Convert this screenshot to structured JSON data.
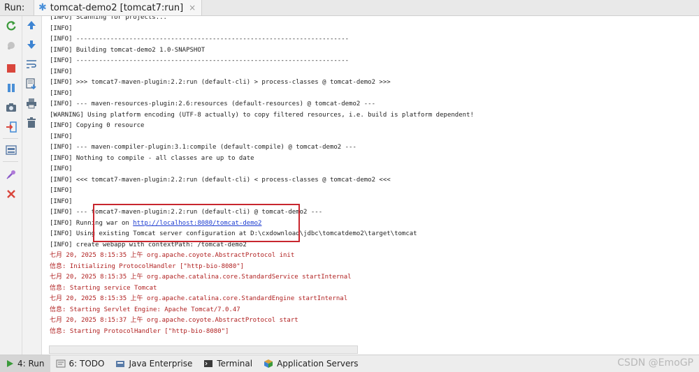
{
  "header": {
    "run_label": "Run:",
    "tab_title": "tomcat-demo2 [tomcat7:run]",
    "tab_close": "×"
  },
  "console": {
    "lines": [
      {
        "text": "[INFO] Scanning for projects...",
        "kind": "info"
      },
      {
        "text": "[INFO]",
        "kind": "info"
      },
      {
        "text": "[INFO] ------------------------------------------------------------------------",
        "kind": "info"
      },
      {
        "text": "[INFO] Building tomcat-demo2 1.0-SNAPSHOT",
        "kind": "info"
      },
      {
        "text": "[INFO] ------------------------------------------------------------------------",
        "kind": "info"
      },
      {
        "text": "[INFO]",
        "kind": "info"
      },
      {
        "text": "[INFO] >>> tomcat7-maven-plugin:2.2:run (default-cli) > process-classes @ tomcat-demo2 >>>",
        "kind": "info"
      },
      {
        "text": "[INFO]",
        "kind": "info"
      },
      {
        "text": "[INFO] --- maven-resources-plugin:2.6:resources (default-resources) @ tomcat-demo2 ---",
        "kind": "info"
      },
      {
        "text": "[WARNING] Using platform encoding (UTF-8 actually) to copy filtered resources, i.e. build is platform dependent!",
        "kind": "info"
      },
      {
        "text": "[INFO] Copying 0 resource",
        "kind": "info"
      },
      {
        "text": "[INFO]",
        "kind": "info"
      },
      {
        "text": "[INFO] --- maven-compiler-plugin:3.1:compile (default-compile) @ tomcat-demo2 ---",
        "kind": "info"
      },
      {
        "text": "[INFO] Nothing to compile - all classes are up to date",
        "kind": "info"
      },
      {
        "text": "[INFO]",
        "kind": "info"
      },
      {
        "text": "[INFO] <<< tomcat7-maven-plugin:2.2:run (default-cli) < process-classes @ tomcat-demo2 <<<",
        "kind": "info"
      },
      {
        "text": "[INFO]",
        "kind": "info"
      },
      {
        "text": "[INFO]",
        "kind": "info"
      },
      {
        "text": "[INFO] --- tomcat7-maven-plugin:2.2:run (default-cli) @ tomcat-demo2 ---",
        "kind": "info"
      },
      {
        "text": "[INFO] Running war on ",
        "kind": "info",
        "link": "http://localhost:8080/tomcat-demo2"
      },
      {
        "text": "[INFO] Using existing Tomcat server configuration at D:\\cxdownload\\jdbc\\tomcatdemo2\\target\\tomcat",
        "kind": "info"
      },
      {
        "text": "[INFO] create webapp with contextPath: /tomcat-demo2",
        "kind": "info"
      },
      {
        "text": "七月 20, 2025 8:15:35 上午 org.apache.coyote.AbstractProtocol init",
        "kind": "err"
      },
      {
        "text": "信息: Initializing ProtocolHandler [\"http-bio-8080\"]",
        "kind": "err"
      },
      {
        "text": "七月 20, 2025 8:15:35 上午 org.apache.catalina.core.StandardService startInternal",
        "kind": "err"
      },
      {
        "text": "信息: Starting service Tomcat",
        "kind": "err"
      },
      {
        "text": "七月 20, 2025 8:15:35 上午 org.apache.catalina.core.StandardEngine startInternal",
        "kind": "err"
      },
      {
        "text": "信息: Starting Servlet Engine: Apache Tomcat/7.0.47",
        "kind": "err"
      },
      {
        "text": "七月 20, 2025 8:15:37 上午 org.apache.coyote.AbstractProtocol start",
        "kind": "err"
      },
      {
        "text": "信息: Starting ProtocolHandler [\"http-bio-8080\"]",
        "kind": "err"
      }
    ]
  },
  "bottom_tabs": [
    {
      "label": "4: Run",
      "icon": "run-icon",
      "active": true
    },
    {
      "label": "6: TODO",
      "icon": "todo-icon",
      "active": false
    },
    {
      "label": "Java Enterprise",
      "icon": "java-enterprise-icon",
      "active": false
    },
    {
      "label": "Terminal",
      "icon": "terminal-icon",
      "active": false
    },
    {
      "label": "Application Servers",
      "icon": "application-servers-icon",
      "active": false
    }
  ],
  "watermark": "CSDN @EmoGP",
  "colors": {
    "error_text": "#b02020",
    "link": "#1a3ad0",
    "highlight_border": "#c8262e"
  }
}
